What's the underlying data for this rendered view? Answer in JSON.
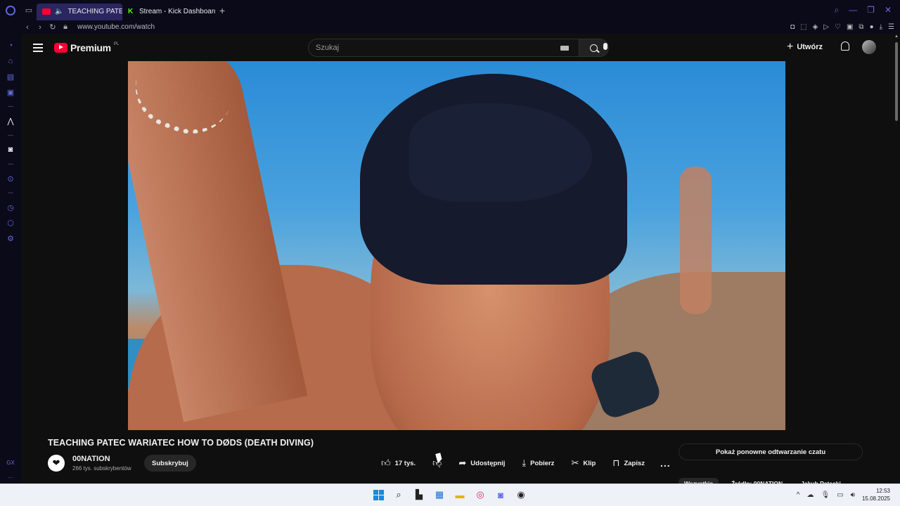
{
  "browser": {
    "tabs": [
      {
        "label": "TEACHING PATEC WA",
        "active": true,
        "favicon": "youtube-icon"
      },
      {
        "label": "Stream - Kick Dashboard",
        "active": false,
        "favicon": "kick-icon"
      }
    ],
    "new_tab_label": "+",
    "url": "www.youtube.com/watch",
    "sidebar_bottom_label": "GX"
  },
  "youtube": {
    "logo_text": "Premium",
    "logo_country": "PL",
    "search_placeholder": "Szukaj",
    "create_label": "Utwórz",
    "video": {
      "title": "TEACHING PATEC WARIATEC HOW TO DØDS (DEATH DIVING)",
      "channel_name": "00NATION",
      "subscribers": "266 tys. subskrybentów",
      "subscribe_label": "Subskrybuj",
      "like_count": "17 tys.",
      "share_label": "Udostępnij",
      "download_label": "Pobierz",
      "clip_label": "Klip",
      "save_label": "Zapisz",
      "more_label": "..."
    },
    "chat_replay_label": "Pokaż ponowne odtwarzanie czatu",
    "chips": [
      "Wszystkie",
      "Źródło: 00NATION",
      "Jakub Patecki"
    ]
  },
  "taskbar": {
    "time": "12:53",
    "date": "15.08.2025"
  },
  "colors": {
    "yt_red": "#ff0033",
    "opera_accent": "#5e6bd8",
    "kick_green": "#53fc18"
  }
}
